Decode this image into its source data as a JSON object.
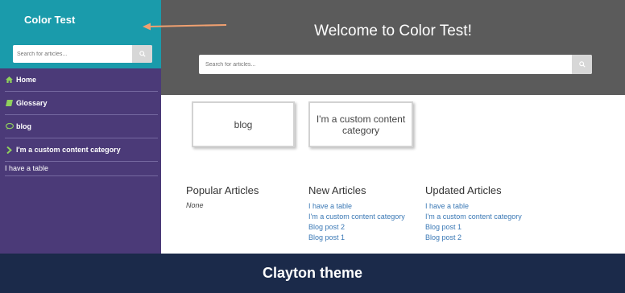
{
  "sidebar": {
    "title": "Color Test",
    "search": {
      "placeholder": "Search for articles..."
    },
    "items": [
      {
        "label": "Home",
        "icon": "home-icon"
      },
      {
        "label": "Glossary",
        "icon": "book-icon"
      },
      {
        "label": "blog",
        "icon": "chat-bubble-icon"
      },
      {
        "label": "I'm a custom content category",
        "icon": "chevron-right-icon"
      }
    ],
    "sub_item": {
      "label": "I have a table"
    }
  },
  "hero": {
    "title": "Welcome to Color Test!",
    "search": {
      "placeholder": "Search for articles..."
    }
  },
  "categories": [
    {
      "label": "blog"
    },
    {
      "label": "I'm a custom content category"
    }
  ],
  "columns": {
    "popular": {
      "title": "Popular Articles",
      "empty": "None"
    },
    "new": {
      "title": "New Articles",
      "items": [
        "I have a table",
        "I'm a custom content category",
        "Blog post 2",
        "Blog post 1"
      ]
    },
    "updated": {
      "title": "Updated Articles",
      "items": [
        "I have a table",
        "I'm a custom content category",
        "Blog post 1",
        "Blog post 2"
      ]
    }
  },
  "footer": {
    "label": "Clayton theme"
  },
  "colors": {
    "sidebar_bg": "#4b3a78",
    "sidebar_header": "#1a9bab",
    "hero_bg": "#5b5b5b",
    "link": "#3a78b5",
    "footer_bg": "#1b2a4a",
    "arrow": "#f0a070"
  }
}
